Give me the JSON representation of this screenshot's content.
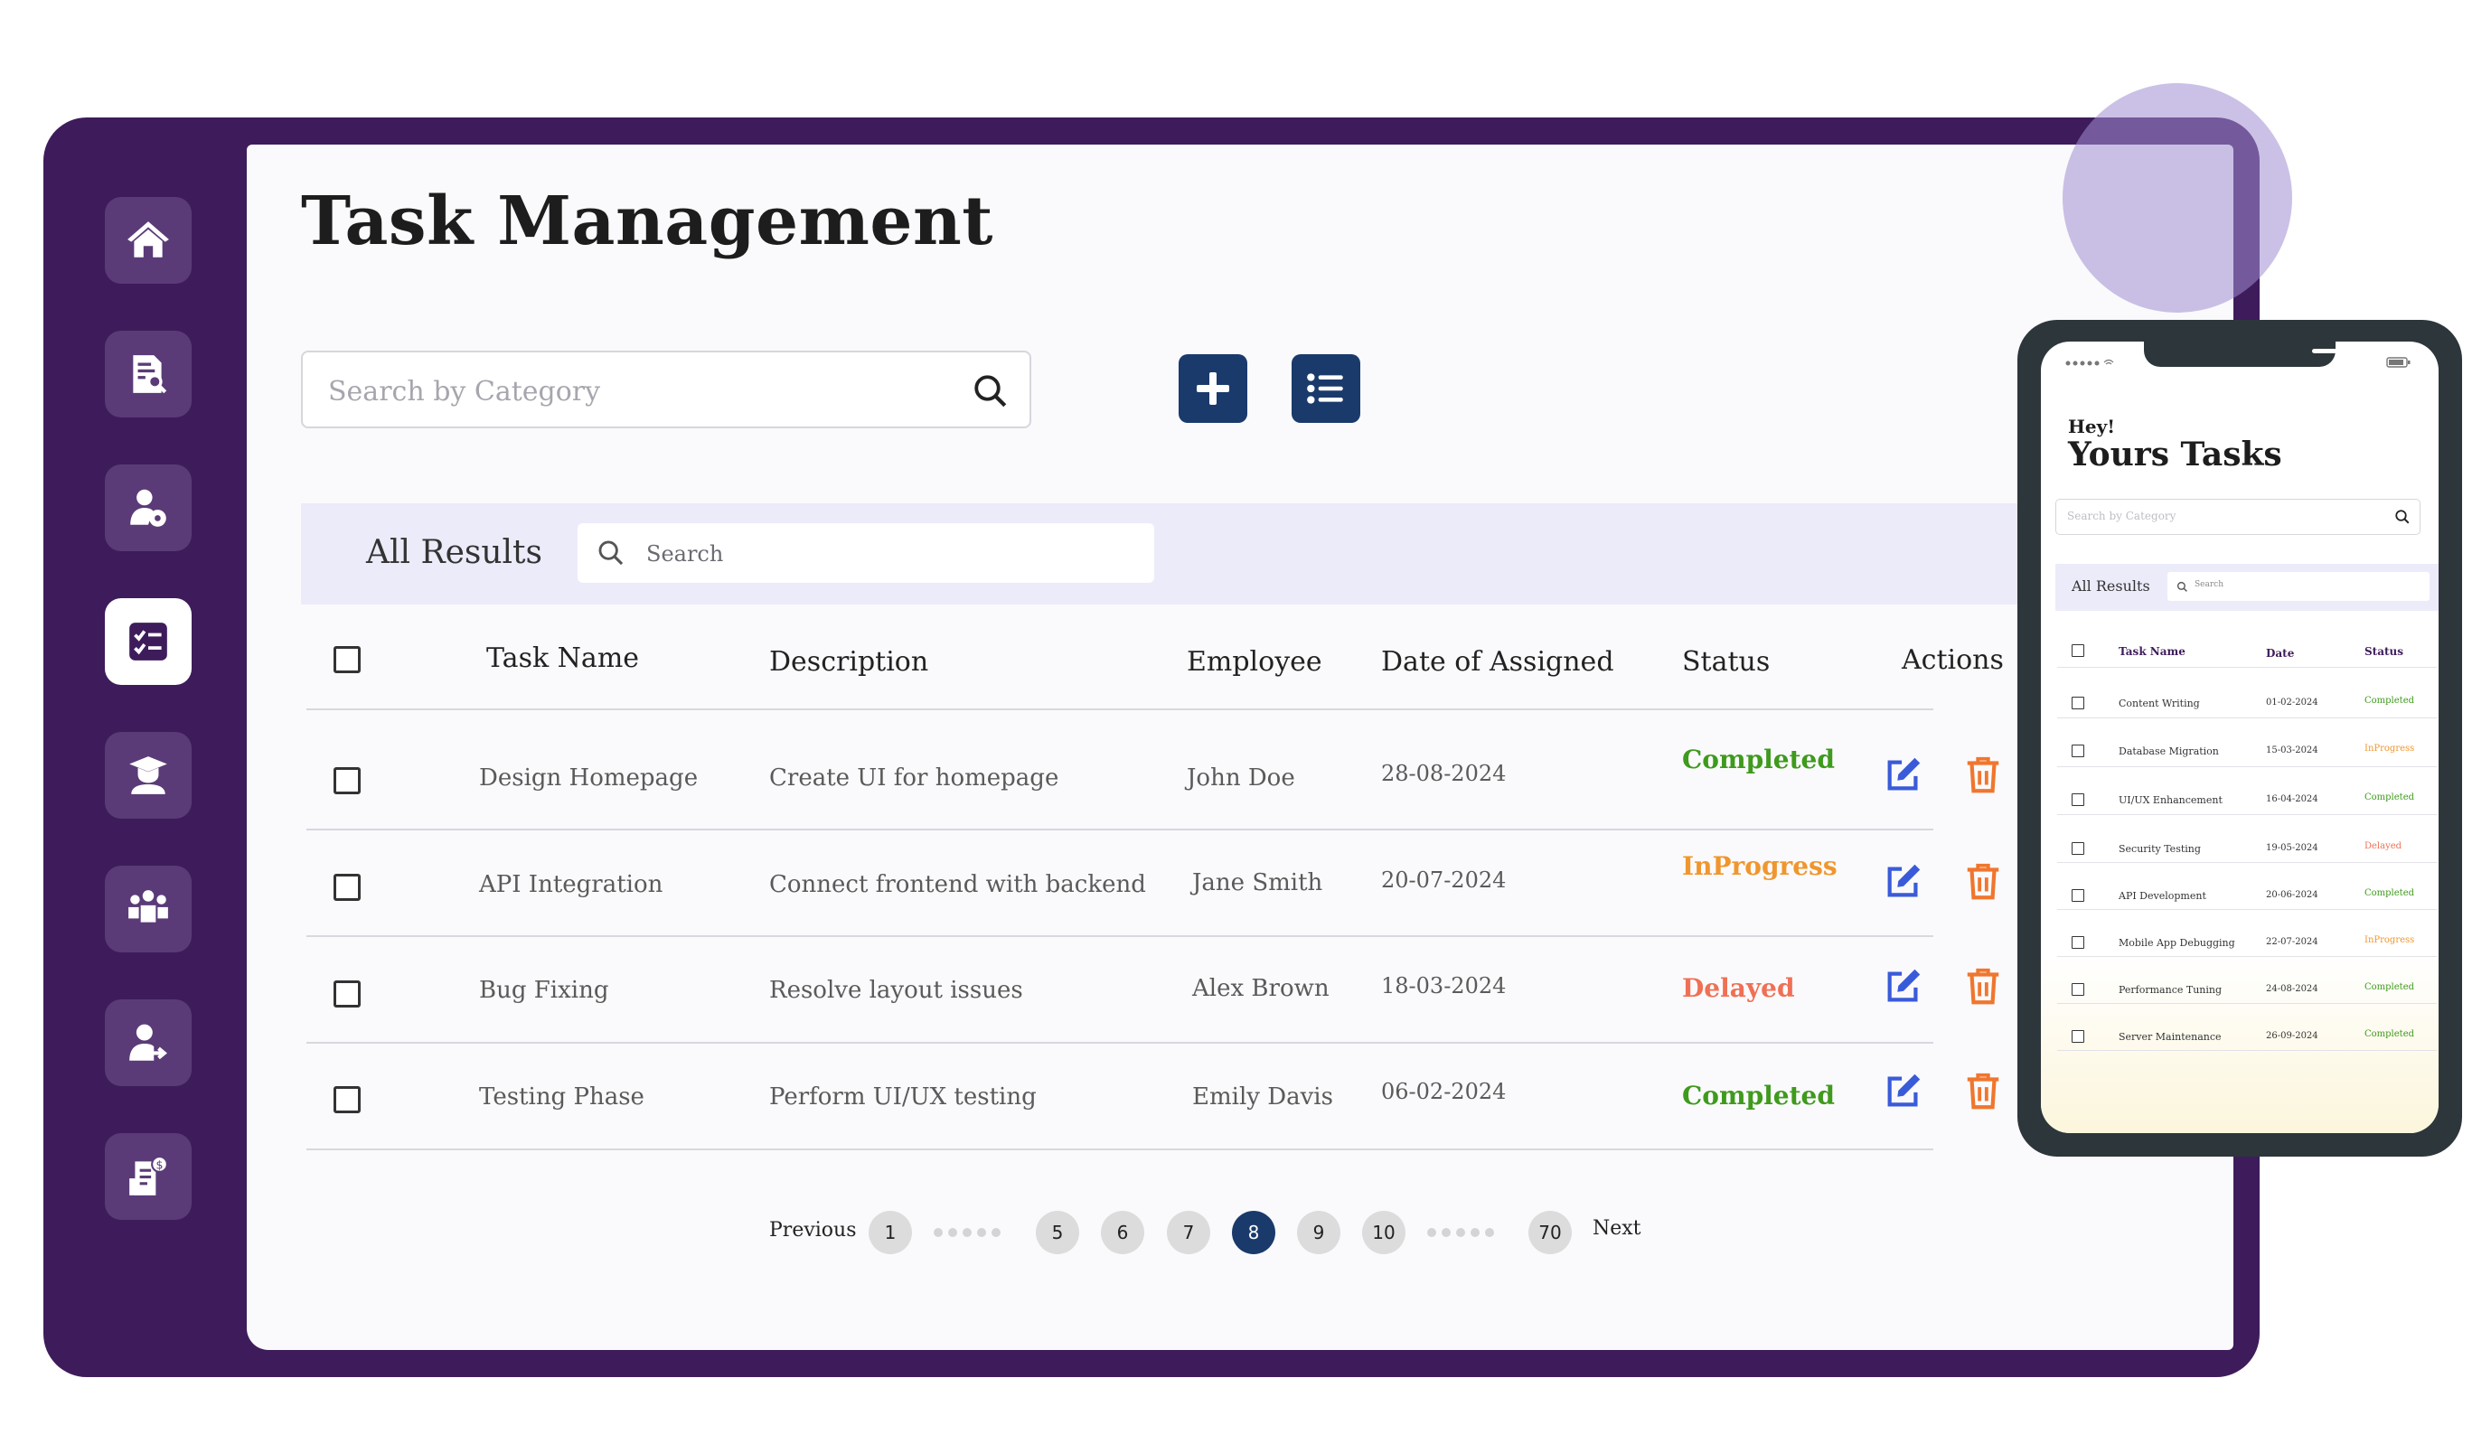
{
  "page": {
    "title": "Task Management"
  },
  "sidebar": {
    "items": [
      {
        "icon": "home-icon"
      },
      {
        "icon": "document-search-icon"
      },
      {
        "icon": "user-settings-icon"
      },
      {
        "icon": "task-checklist-icon",
        "active": true
      },
      {
        "icon": "graduate-icon"
      },
      {
        "icon": "team-icon"
      },
      {
        "icon": "user-transfer-icon"
      },
      {
        "icon": "payroll-icon"
      }
    ]
  },
  "search": {
    "placeholder": "Search by Category"
  },
  "toolbar": {
    "add_icon": "plus-icon",
    "list_icon": "list-icon"
  },
  "results": {
    "label": "All Results",
    "search_placeholder": "Search"
  },
  "table": {
    "headers": [
      "Task Name",
      "Description",
      "Employee",
      "Date of Assigned",
      "Status",
      "Actions"
    ],
    "rows": [
      {
        "task": "Design Homepage",
        "description": "Create UI for homepage",
        "employee": "John Doe",
        "date": "28-08-2024",
        "status": "Completed"
      },
      {
        "task": "API Integration",
        "description": "Connect frontend with backend",
        "employee": "Jane Smith",
        "date": "20-07-2024",
        "status": "InProgress"
      },
      {
        "task": "Bug Fixing",
        "description": "Resolve layout issues",
        "employee": "Alex Brown",
        "date": "18-03-2024",
        "status": "Delayed"
      },
      {
        "task": "Testing Phase",
        "description": "Perform UI/UX testing",
        "employee": "Emily Davis",
        "date": "06-02-2024",
        "status": "Completed"
      }
    ]
  },
  "pagination": {
    "previous": "Previous",
    "next": "Next",
    "pages": [
      "1",
      "5",
      "6",
      "7",
      "8",
      "9",
      "10",
      "70"
    ],
    "current": "8"
  },
  "colors": {
    "frame": "#3e1c5b",
    "primary": "#1a3a6b",
    "completed": "#3f9a1d",
    "inprogress": "#f0962e",
    "delayed": "#f07055",
    "edit": "#3a5bd9",
    "delete": "#f0762e"
  },
  "phone": {
    "greeting": "Hey!",
    "title": "Yours Tasks",
    "search_placeholder": "Search by Category",
    "results_label": "All Results",
    "results_search_placeholder": "Search",
    "headers": [
      "Task Name",
      "Date",
      "Status"
    ],
    "rows": [
      {
        "task": "Content Writing",
        "date": "01-02-2024",
        "status": "Completed"
      },
      {
        "task": "Database Migration",
        "date": "15-03-2024",
        "status": "InProgress"
      },
      {
        "task": "UI/UX Enhancement",
        "date": "16-04-2024",
        "status": "Completed"
      },
      {
        "task": "Security Testing",
        "date": "19-05-2024",
        "status": "Delayed"
      },
      {
        "task": "API Development",
        "date": "20-06-2024",
        "status": "Completed"
      },
      {
        "task": "Mobile App Debugging",
        "date": "22-07-2024",
        "status": "InProgress"
      },
      {
        "task": "Performance Tuning",
        "date": "24-08-2024",
        "status": "Completed"
      },
      {
        "task": "Server Maintenance",
        "date": "26-09-2024",
        "status": "Completed"
      }
    ]
  }
}
